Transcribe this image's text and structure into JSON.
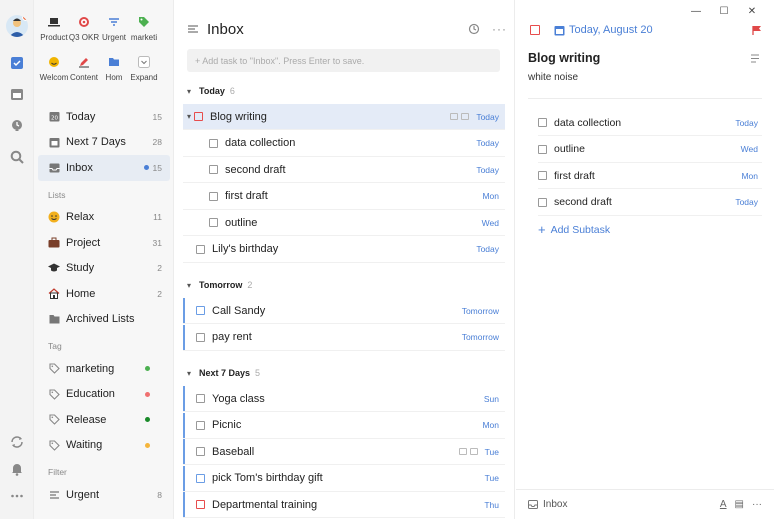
{
  "apps": [
    {
      "label": "Product",
      "icon": "laptop-icon",
      "color": "#3b3b3b"
    },
    {
      "label": "Q3 OKR",
      "icon": "target-icon",
      "color": "#e04848"
    },
    {
      "label": "Urgent",
      "icon": "filter-icon",
      "color": "#4a7fd6"
    },
    {
      "label": "marketi",
      "icon": "tag-icon",
      "color": "#4cb050"
    },
    {
      "label": "Welcom",
      "icon": "smile-icon",
      "color": "#f0b400"
    },
    {
      "label": "Content",
      "icon": "pencil-icon",
      "color": "#e04848"
    },
    {
      "label": "Hom",
      "icon": "folder-icon",
      "color": "#4a7fd6"
    },
    {
      "label": "Expand",
      "icon": "chevron-down-icon",
      "color": "#777"
    }
  ],
  "smart_lists": [
    {
      "label": "Today",
      "count": "15",
      "icon": "calendar-today-icon"
    },
    {
      "label": "Next 7 Days",
      "count": "28",
      "icon": "calendar-week-icon"
    },
    {
      "label": "Inbox",
      "count": "15",
      "icon": "inbox-icon",
      "active": true
    }
  ],
  "lists_label": "Lists",
  "lists": [
    {
      "label": "Relax",
      "count": "11",
      "icon": "smile-emoji-icon"
    },
    {
      "label": "Project",
      "count": "31",
      "icon": "briefcase-icon"
    },
    {
      "label": "Study",
      "count": "2",
      "icon": "graduation-cap-icon"
    },
    {
      "label": "Home",
      "count": "2",
      "icon": "house-icon"
    },
    {
      "label": "Archived Lists",
      "count": "",
      "icon": "archive-folder-icon"
    }
  ],
  "tag_label": "Tag",
  "tags": [
    {
      "label": "marketing",
      "color": "#4cb050"
    },
    {
      "label": "Education",
      "color": "#f07070"
    },
    {
      "label": "Release",
      "color": "#1a8a2a"
    },
    {
      "label": "Waiting",
      "color": "#f5b53b"
    }
  ],
  "filter_label": "Filter",
  "filters": [
    {
      "label": "Urgent",
      "count": "8"
    }
  ],
  "inbox": {
    "title": "Inbox",
    "add_placeholder": "+ Add task to \"Inbox\". Press Enter to save."
  },
  "groups": [
    {
      "name": "Today",
      "count": "6",
      "tasks": [
        {
          "name": "Blog writing",
          "date": "Today",
          "selected": true,
          "priority": "red",
          "icons": true
        },
        {
          "name": "data collection",
          "date": "Today",
          "sub": true
        },
        {
          "name": "second draft",
          "date": "Today",
          "sub": true
        },
        {
          "name": "first draft",
          "date": "Mon",
          "sub": true
        },
        {
          "name": "outline",
          "date": "Wed",
          "sub": true
        },
        {
          "name": "Lily's birthday",
          "date": "Today"
        }
      ]
    },
    {
      "name": "Tomorrow",
      "count": "2",
      "tasks": [
        {
          "name": "Call Sandy",
          "date": "Tomorrow",
          "bar": true,
          "priority": "blue"
        },
        {
          "name": "pay rent",
          "date": "Tomorrow",
          "bar": true
        }
      ]
    },
    {
      "name": "Next 7 Days",
      "count": "5",
      "tasks": [
        {
          "name": "Yoga class",
          "date": "Sun",
          "bar": true
        },
        {
          "name": "Picnic",
          "date": "Mon",
          "bar": true
        },
        {
          "name": "Baseball",
          "date": "Tue",
          "bar": true,
          "icons": true
        },
        {
          "name": "pick Tom's birthday gift",
          "date": "Tue",
          "bar": true,
          "priority": "blue"
        },
        {
          "name": "Departmental training",
          "date": "Thu",
          "bar": true,
          "priority": "red"
        }
      ]
    }
  ],
  "detail": {
    "date": "Today, August 20",
    "title": "Blog writing",
    "note": "white noise",
    "subtasks": [
      {
        "name": "data collection",
        "date": "Today"
      },
      {
        "name": "outline",
        "date": "Wed"
      },
      {
        "name": "first draft",
        "date": "Mon"
      },
      {
        "name": "second draft",
        "date": "Today"
      }
    ],
    "add_subtask": "Add Subtask",
    "project": "Inbox",
    "flag_color": "#e04848"
  },
  "accent": "#4a7fd6"
}
